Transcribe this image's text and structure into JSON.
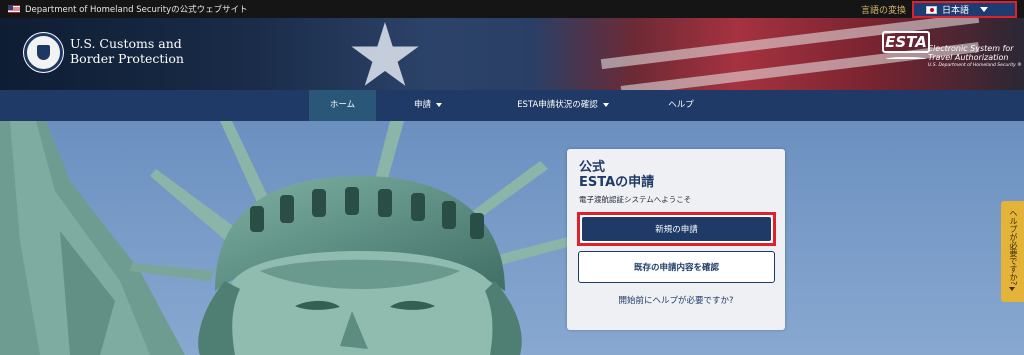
{
  "topbar": {
    "gov_notice": "Department of Homeland Securityの公式ウェブサイト",
    "language_change": "言語の変換",
    "language_selected": "日本語"
  },
  "header": {
    "agency_line1": "U.S. Customs and",
    "agency_line2": "Border Protection",
    "esta_mark": "ESTA",
    "esta_line1": "Electronic System for",
    "esta_line2": "Travel Authorization",
    "esta_dept": "U.S. Department of Homeland Security ®"
  },
  "nav": {
    "items": [
      {
        "label": "ホーム",
        "active": true,
        "dropdown": false
      },
      {
        "label": "申請",
        "active": false,
        "dropdown": true
      },
      {
        "label": "ESTA申請状況の確認",
        "active": false,
        "dropdown": true
      },
      {
        "label": "ヘルプ",
        "active": false,
        "dropdown": false
      }
    ]
  },
  "card": {
    "title_line1": "公式",
    "title_line2": "ESTAの申請",
    "subtitle": "電子渡航認証システムへようこそ",
    "new_application": "新規の申請",
    "existing_application": "既存の申請内容を確認",
    "help_link": "開始前にヘルプが必要ですか?"
  },
  "side_tab": {
    "label": "ヘルプが必要ですか?"
  },
  "colors": {
    "navy": "#1f3a66",
    "highlight_red": "#e0202a",
    "help_tab": "#e4b33a",
    "active_nav": "#2a5778"
  }
}
